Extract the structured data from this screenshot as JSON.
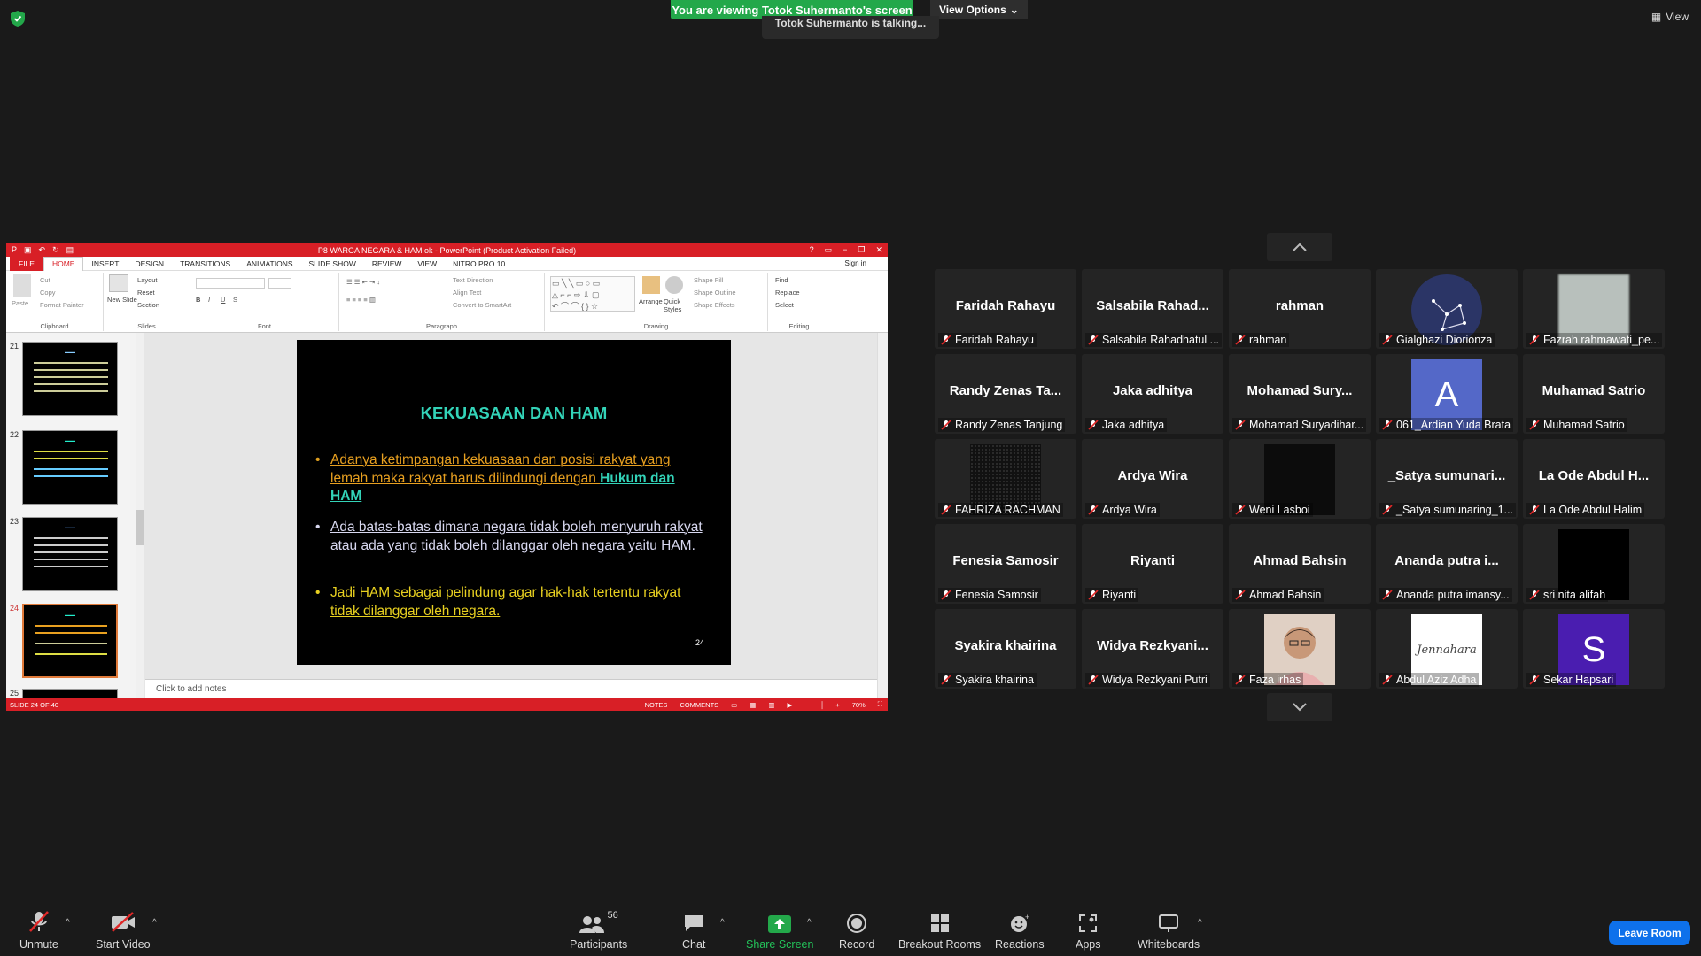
{
  "banner": {
    "sharing_text": "You are viewing Totok Suhermanto's screen",
    "view_options": "View Options",
    "talking": "Totok Suhermanto is talking...",
    "view": "View"
  },
  "ppt": {
    "title": "P8 WARGA NEGARA & HAM ok - PowerPoint (Product Activation Failed)",
    "tabs": [
      "FILE",
      "HOME",
      "INSERT",
      "DESIGN",
      "TRANSITIONS",
      "ANIMATIONS",
      "SLIDE SHOW",
      "REVIEW",
      "VIEW",
      "NITRO PRO 10"
    ],
    "sign_in": "Sign in",
    "groups": {
      "clipboard": "Clipboard",
      "slides": "Slides",
      "font": "Font",
      "paragraph": "Paragraph",
      "drawing": "Drawing",
      "editing": "Editing"
    },
    "ribbon_items": {
      "paste": "Paste",
      "cut": "Cut",
      "copy": "Copy",
      "format_painter": "Format Painter",
      "new_slide": "New Slide",
      "layout": "Layout",
      "reset": "Reset",
      "section": "Section",
      "text_direction": "Text Direction",
      "align_text": "Align Text",
      "convert_smartart": "Convert to SmartArt",
      "arrange": "Arrange",
      "quick_styles": "Quick Styles",
      "shape_fill": "Shape Fill",
      "shape_outline": "Shape Outline",
      "shape_effects": "Shape Effects",
      "find": "Find",
      "replace": "Replace",
      "select": "Select"
    },
    "thumb_numbers": [
      "21",
      "22",
      "23",
      "24",
      "25"
    ],
    "slide": {
      "title": "KEKUASAAN DAN HAM",
      "bullet1_a": "Adanya ketimpangan kekuasaan dan posisi rakyat yang lemah maka rakyat harus dilindungi dengan ",
      "bullet1_b": "Hukum dan HAM",
      "bullet2": "Ada batas-batas dimana negara tidak boleh menyuruh rakyat atau ada yang tidak boleh dilanggar oleh negara yaitu HAM.",
      "bullet3": "Jadi HAM sebagai pelindung agar hak-hak tertentu rakyat tidak dilanggar oleh negara.",
      "number": "24"
    },
    "notes_placeholder": "Click to add notes",
    "status": {
      "slide_of": "SLIDE 24 OF 40",
      "notes": "NOTES",
      "comments": "COMMENTS",
      "zoom": "70%"
    }
  },
  "participants": [
    {
      "big": "Faridah Rahayu",
      "label": "Faridah Rahayu"
    },
    {
      "big": "Salsabila  Rahad...",
      "label": "Salsabila Rahadhatul ..."
    },
    {
      "big": "rahman",
      "label": "rahman"
    },
    {
      "big": "",
      "label": "Gialghazi Diorionza"
    },
    {
      "big": "",
      "label": "Fazrah rahmawati_pe..."
    },
    {
      "big": "Randy  Zenas  Ta...",
      "label": "Randy Zenas Tanjung"
    },
    {
      "big": "Jaka  adhitya",
      "label": "Jaka adhitya"
    },
    {
      "big": "Mohamad  Sury...",
      "label": "Mohamad Suryadihar..."
    },
    {
      "big": "A",
      "label": "061_Ardian Yuda Brata"
    },
    {
      "big": "Muhamad Satrio",
      "label": "Muhamad Satrio"
    },
    {
      "big": "",
      "label": "FAHRIZA RACHMAN"
    },
    {
      "big": "Ardya Wira",
      "label": "Ardya Wira"
    },
    {
      "big": "",
      "label": "Weni Lasboi"
    },
    {
      "big": "_Satya  sumunari...",
      "label": "_Satya sumunaring_1..."
    },
    {
      "big": "La Ode Abdul H...",
      "label": "La Ode Abdul Halim"
    },
    {
      "big": "Fenesia Samosir",
      "label": "Fenesia Samosir"
    },
    {
      "big": "Riyanti",
      "label": "Riyanti"
    },
    {
      "big": "Ahmad Bahsin",
      "label": "Ahmad Bahsin"
    },
    {
      "big": "Ananda  putra  i...",
      "label": "Ananda putra imansy..."
    },
    {
      "big": "",
      "label": "sri nita alifah"
    },
    {
      "big": "Syakira khairina",
      "label": "Syakira khairina"
    },
    {
      "big": "Widya  Rezkyani...",
      "label": "Widya Rezkyani Putri"
    },
    {
      "big": "",
      "label": "Faza irhas"
    },
    {
      "big": "Jennahara",
      "label": "Abdul Aziz Adha"
    },
    {
      "big": "S",
      "label": "Sekar Hapsari"
    }
  ],
  "toolbar": {
    "unmute": "Unmute",
    "start_video": "Start Video",
    "participants": "Participants",
    "participants_count": "56",
    "chat": "Chat",
    "share_screen": "Share Screen",
    "record": "Record",
    "breakout": "Breakout Rooms",
    "reactions": "Reactions",
    "apps": "Apps",
    "whiteboards": "Whiteboards",
    "leave": "Leave Room"
  },
  "colors": {
    "share_green": "#23a84a",
    "ppt_red": "#d81f26",
    "leave_blue": "#0e71eb",
    "mic_red": "#e02828"
  }
}
